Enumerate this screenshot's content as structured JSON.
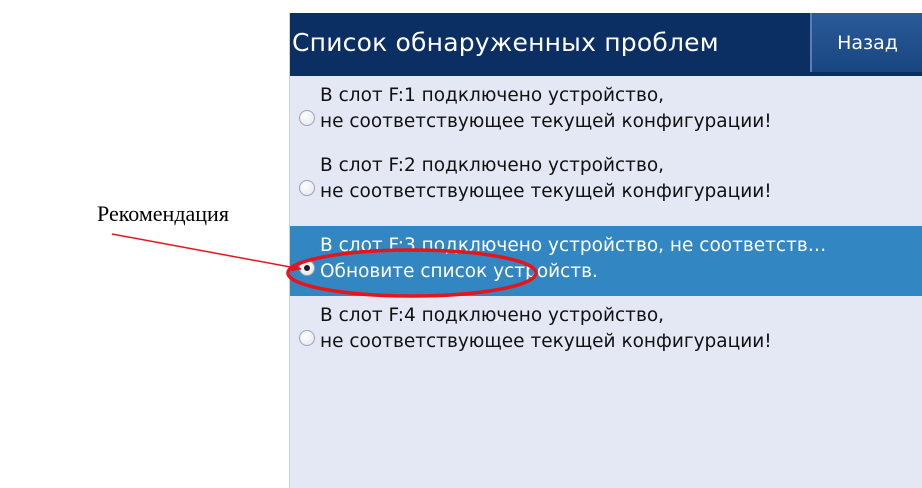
{
  "screen": {
    "title": "Список обнаруженных проблем",
    "back_label": "Назад"
  },
  "problems": [
    {
      "line1": "В слот F:1 подключено устройство,",
      "line2": "не соответствующее текущей конфигурации!",
      "selected": false
    },
    {
      "line1": "В слот F:2 подключено устройство,",
      "line2": "не соответствующее текущей конфигурации!",
      "selected": false
    },
    {
      "line1": "В слот F:3 подключено устройство, не соответств…",
      "line2": "Обновите список устройств.",
      "selected": true
    },
    {
      "line1": "В слот F:4 подключено устройство,",
      "line2": "не соответствующее текущей конфигурации!",
      "selected": false
    }
  ],
  "annotation": {
    "label": "Рекомендация",
    "color": "#e8141c"
  },
  "colors": {
    "header_bg": "#0b2f63",
    "list_bg": "#e3e8f4",
    "selected_bg": "#3287c2"
  }
}
